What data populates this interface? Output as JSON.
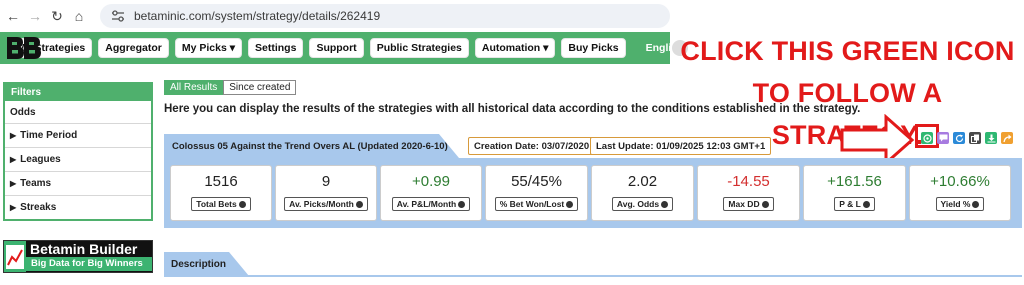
{
  "browser": {
    "url": "betaminic.com/system/strategy/details/262419",
    "nav": {
      "back": "←",
      "forward": "→",
      "reload": "↻",
      "home": "⌂"
    }
  },
  "menu": {
    "items": [
      "My Strategies",
      "Aggregator",
      "My Picks ▾",
      "Settings",
      "Support",
      "Public Strategies",
      "Automation ▾",
      "Buy Picks"
    ],
    "language": "English"
  },
  "callout": {
    "line1": "CLICK THIS GREEN ICON",
    "line2": "TO FOLLOW A STRATEGY."
  },
  "filters": {
    "title": "Filters",
    "rows": [
      {
        "label": "Odds",
        "expandable": false
      },
      {
        "label": "Time Period",
        "expandable": true
      },
      {
        "label": "Leagues",
        "expandable": true
      },
      {
        "label": "Teams",
        "expandable": true
      },
      {
        "label": "Streaks",
        "expandable": true
      }
    ]
  },
  "builder": {
    "title": "Betamin Builder",
    "tagline": "Big Data for Big Winners"
  },
  "tabs": {
    "all_results": "All Results",
    "since_created": "Since created"
  },
  "intro": "Here you can display the results of the strategies with all historical data according to the conditions established in the strategy.",
  "strategy": {
    "title": "Colossus 05 Against the Trend Overs AL (Updated 2020-6-10)",
    "creation_date": "Creation Date: 03/07/2020",
    "last_update": "Last Update: 01/09/2025 12:03 GMT+1"
  },
  "actions": [
    {
      "name": "follow-button",
      "icon": "follow-icon",
      "color": "#2eb872"
    },
    {
      "name": "message-button",
      "icon": "comment-icon",
      "color": "#a77be0"
    },
    {
      "name": "refresh-button",
      "icon": "refresh-icon",
      "color": "#2b8ad8"
    },
    {
      "name": "copy-button",
      "icon": "copy-icon",
      "color": "#4a4a4a"
    },
    {
      "name": "download-button",
      "icon": "download-icon",
      "color": "#2eb872"
    },
    {
      "name": "share-button",
      "icon": "share-icon",
      "color": "#f0a030"
    }
  ],
  "stats": [
    {
      "value": "1516",
      "label": "Total Bets",
      "color": "#222222"
    },
    {
      "value": "9",
      "label": "Av. Picks/Month",
      "color": "#222222"
    },
    {
      "value": "+0.99",
      "label": "Av. P&L/Month",
      "color": "#2e7d32"
    },
    {
      "value": "55/45%",
      "label": "% Bet Won/Lost",
      "color": "#222222"
    },
    {
      "value": "2.02",
      "label": "Avg. Odds",
      "color": "#222222"
    },
    {
      "value": "-14.55",
      "label": "Max DD",
      "color": "#d32f2f"
    },
    {
      "value": "+161.56",
      "label": "P & L",
      "color": "#2e7d32"
    },
    {
      "value": "+10.66%",
      "label": "Yield %",
      "color": "#2e7d32"
    }
  ],
  "description": {
    "title": "Description"
  }
}
